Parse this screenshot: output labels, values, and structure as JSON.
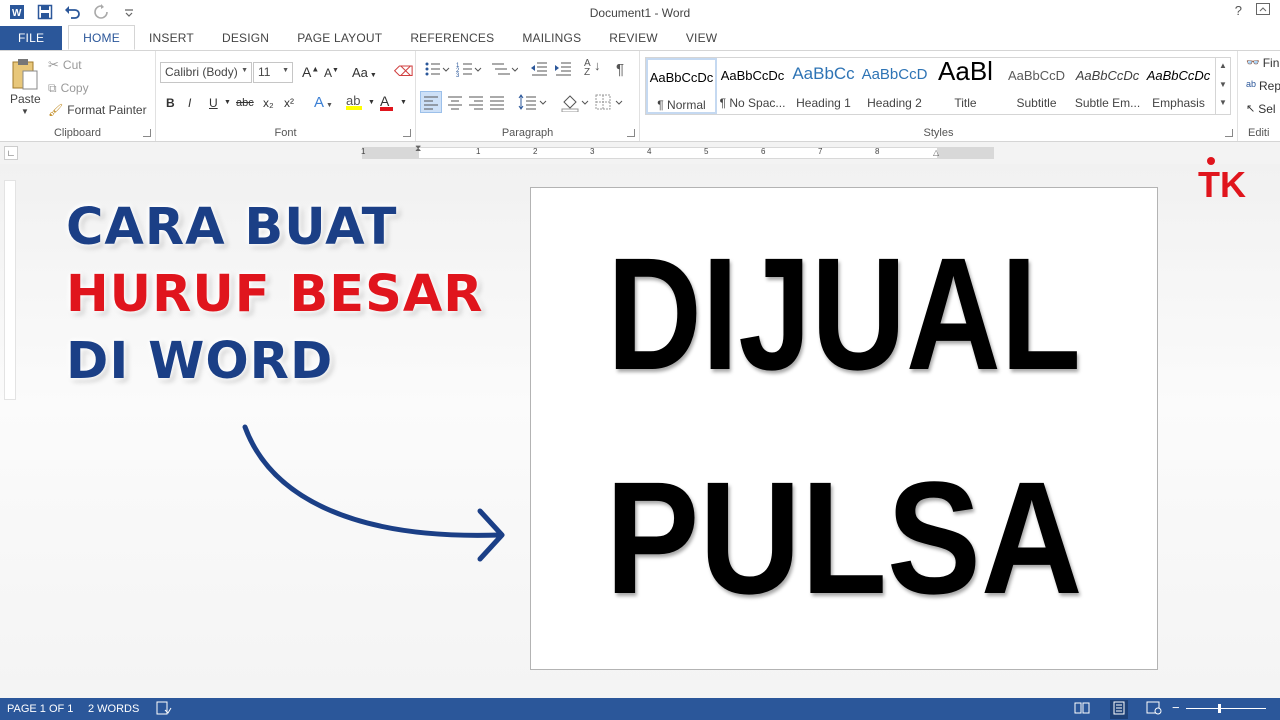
{
  "window": {
    "title": "Document1 - Word",
    "help": "?",
    "restore_icon": "ribbon-display-icon"
  },
  "qat": {
    "icons": [
      "word-app-icon",
      "save-icon",
      "undo-icon",
      "redo-icon",
      "customize-qat-icon"
    ]
  },
  "tabs": [
    {
      "label": "FILE"
    },
    {
      "label": "HOME"
    },
    {
      "label": "INSERT"
    },
    {
      "label": "DESIGN"
    },
    {
      "label": "PAGE LAYOUT"
    },
    {
      "label": "REFERENCES"
    },
    {
      "label": "MAILINGS"
    },
    {
      "label": "REVIEW"
    },
    {
      "label": "VIEW"
    }
  ],
  "clipboard": {
    "paste": "Paste",
    "cut": "Cut",
    "copy": "Copy",
    "format_painter": "Format Painter",
    "label": "Clipboard"
  },
  "font": {
    "family": "Calibri (Body)",
    "size": "11",
    "label": "Font",
    "grow": "A",
    "shrink": "A",
    "case": "Aa",
    "bold": "B",
    "italic": "I",
    "underline": "U",
    "strike": "abc",
    "sub": "x₂",
    "sup": "x²"
  },
  "paragraph": {
    "label": "Paragraph",
    "pilcrow": "¶"
  },
  "styles": {
    "label": "Styles",
    "items": [
      {
        "preview": "AaBbCcDc",
        "name": "¶ Normal",
        "color": "#000000"
      },
      {
        "preview": "AaBbCcDc",
        "name": "¶ No Spac...",
        "color": "#000000"
      },
      {
        "preview": "AaBbCc",
        "name": "Heading 1",
        "color": "#2e74b5"
      },
      {
        "preview": "AaBbCcD",
        "name": "Heading 2",
        "color": "#2e74b5"
      },
      {
        "preview": "AaBl",
        "name": "Title",
        "color": "#000000"
      },
      {
        "preview": "AaBbCcD",
        "name": "Subtitle",
        "color": "#5a5a5a"
      },
      {
        "preview": "AaBbCcDc",
        "name": "Subtle Em...",
        "color": "#404040"
      },
      {
        "preview": "AaBbCcDc",
        "name": "Emphasis",
        "color": "#000000"
      }
    ]
  },
  "editing": {
    "find": "Fin",
    "replace": "Rep",
    "select": "Sel",
    "label": "Editi"
  },
  "ruler": {
    "numbers": [
      "1",
      "1",
      "2",
      "3",
      "4",
      "5",
      "6",
      "7",
      "8"
    ]
  },
  "overlay": {
    "line1": "CARA BUAT",
    "line2": "HURUF BESAR",
    "line3": "DI WORD",
    "navy": "#1b3f86",
    "red": "#e0151d"
  },
  "document": {
    "line1": "DIJUAL",
    "line2": "PULSA"
  },
  "logo": {
    "text": "TK",
    "color": "#e0151d"
  },
  "status": {
    "page": "PAGE 1 OF 1",
    "words": "2 WORDS",
    "bg": "#2b579a"
  }
}
